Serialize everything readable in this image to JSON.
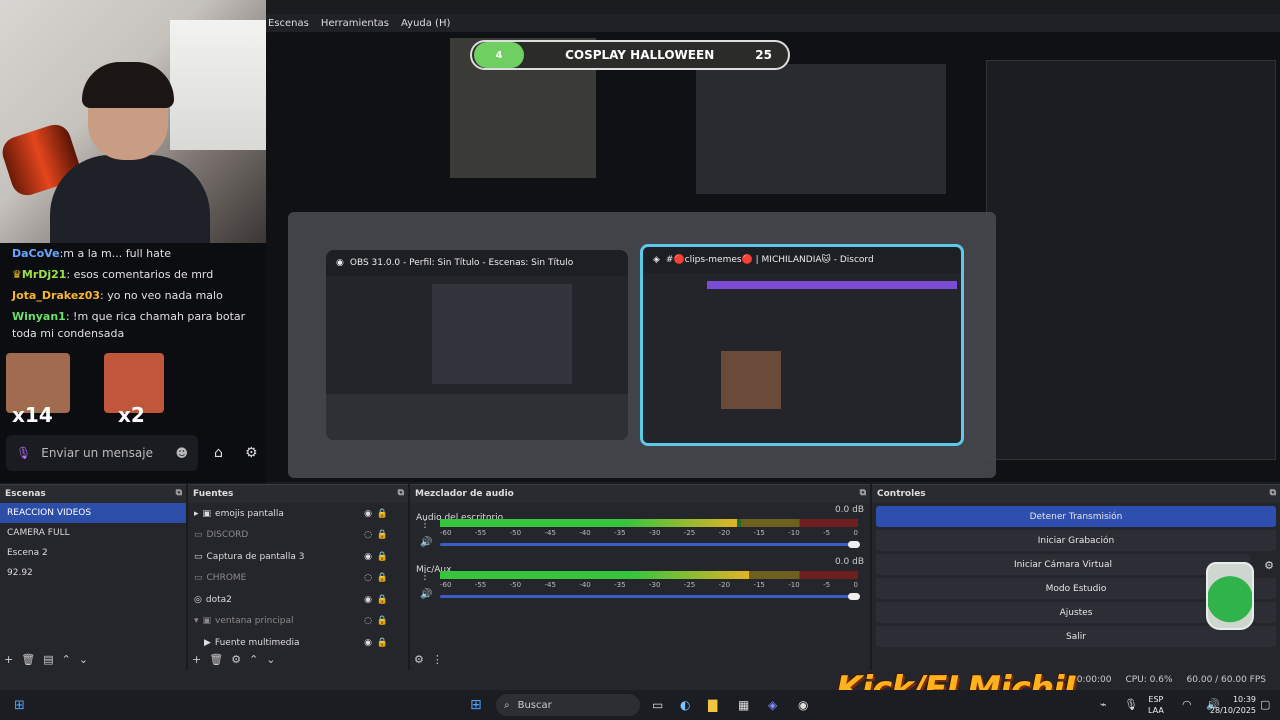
{
  "menu": [
    "Escenas",
    "Herramientas",
    "Ayuda (H)"
  ],
  "overlay": {
    "title": "COSPLAY HALLOWEEN",
    "count_left": "4",
    "count_right": "25"
  },
  "chat": {
    "messages": [
      {
        "user": "DaCoVe",
        "text": ":m a la m... full hate",
        "color": "#6aa8ff"
      },
      {
        "user": "MrDj21",
        "text": ": esos comentarios de mrd",
        "color": "#9ee04b"
      },
      {
        "user": "Jota_Drakez03",
        "text": ": yo no veo nada malo",
        "color": "#f7b733"
      },
      {
        "user": "Winyan1",
        "text": ": !m que rica chamah para botar toda mi condensada",
        "color": "#6ae06a"
      }
    ],
    "emote_counts": [
      "x14",
      "x2"
    ],
    "input_placeholder": "Enviar un mensaje"
  },
  "switcher": {
    "obs_title": "OBS 31.0.0 - Perfil: Sin Título - Escenas: Sin Título",
    "discord_title": "#🔴clips-memes🔴 | MICHILANDIA🐱 - Discord"
  },
  "scenes": {
    "title": "Escenas",
    "items": [
      "REACCION VIDEOS",
      "CAMERA FULL",
      "Escena 2",
      "92.92"
    ]
  },
  "sources": {
    "title": "Fuentes",
    "items": [
      {
        "label": "emojis pantalla",
        "dim": false
      },
      {
        "label": "DISCORD",
        "dim": true
      },
      {
        "label": "Captura de pantalla 3",
        "dim": false
      },
      {
        "label": "CHROME",
        "dim": true
      },
      {
        "label": "dota2",
        "dim": false
      },
      {
        "label": "ventana principal",
        "dim": true
      },
      {
        "label": "Fuente multimedia",
        "dim": false
      }
    ]
  },
  "mixer": {
    "title": "Mezclador de audio",
    "channels": [
      {
        "name": "Audio del escritorio",
        "db": "0.0 dB",
        "level": 0.71
      },
      {
        "name": "Mic/Aux",
        "db": "0.0 dB",
        "level": 0.74
      }
    ],
    "scale": [
      "-60",
      "-55",
      "-50",
      "-45",
      "-40",
      "-35",
      "-30",
      "-25",
      "-20",
      "-15",
      "-10",
      "-5",
      "0"
    ]
  },
  "controls": {
    "title": "Controles",
    "buttons": [
      "Detener Transmisión",
      "Iniciar Grabación",
      "Iniciar Cámara Virtual",
      "Modo Estudio",
      "Ajustes",
      "Salir"
    ]
  },
  "status": {
    "time": "00:00:00",
    "cpu": "CPU: 0.6%",
    "fps": "60.00 / 60.00 FPS"
  },
  "kick": "Kick/ELMichiJ",
  "taskbar": {
    "search": "Buscar",
    "lang": "ESP",
    "lang2": "LAA",
    "time": "10:39",
    "date": "28/10/2025"
  }
}
